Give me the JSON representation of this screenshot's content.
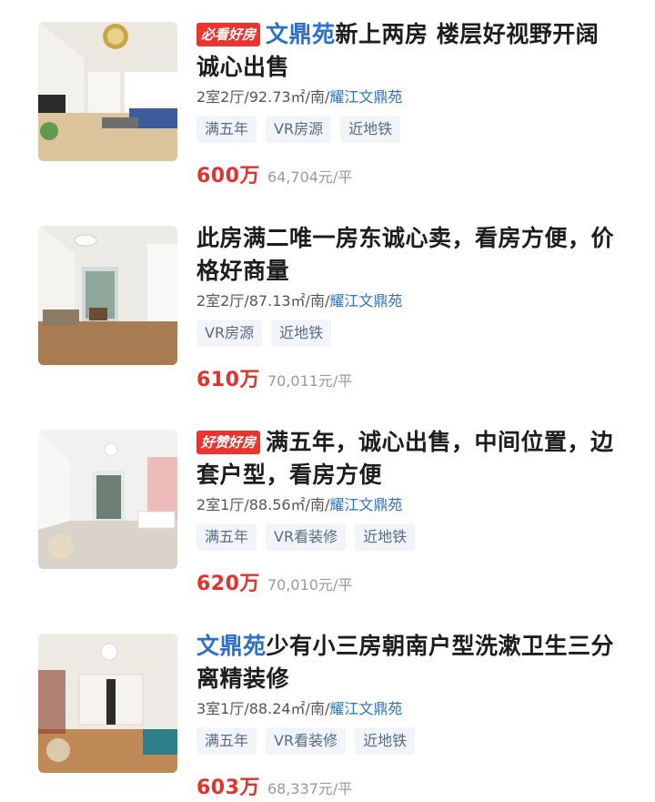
{
  "listings": [
    {
      "badge": "必看好房",
      "title_keyword": "文鼎苑",
      "title": "新上两房  楼层好视野开阔 诚心出售",
      "meta_prefix": "2室2厅/92.73㎡/南/",
      "community": "耀江文鼎苑",
      "tags": [
        "满五年",
        "VR房源",
        "近地铁"
      ],
      "price": "600万",
      "unit_price": "64,704元/平",
      "colors": {
        "wall": "#e9e6df",
        "floor": "#d9c29c",
        "sofa": "#3b5a99"
      }
    },
    {
      "badge": "",
      "title_keyword": "",
      "title": "此房满二唯一房东诚心卖，看房方便，价格好商量",
      "meta_prefix": "2室2厅/87.13㎡/南/",
      "community": "耀江文鼎苑",
      "tags": [
        "VR房源",
        "近地铁"
      ],
      "price": "610万",
      "unit_price": "70,011元/平",
      "colors": {
        "wall": "#ecebe7",
        "floor": "#a87a52",
        "sofa": "#8c7b66"
      }
    },
    {
      "badge": "好赞好房",
      "title_keyword": "",
      "title": "满五年，诚心出售，中间位置，边套户型，看房方便",
      "meta_prefix": "2室1厅/88.56㎡/南/",
      "community": "耀江文鼎苑",
      "tags": [
        "满五年",
        "VR看装修",
        "近地铁"
      ],
      "price": "620万",
      "unit_price": "70,010元/平",
      "colors": {
        "wall": "#f1f1ef",
        "floor": "#d8d2c8",
        "sofa": "#cfcfcf"
      }
    },
    {
      "badge": "",
      "title_keyword": "文鼎苑",
      "title": "少有小三房朝南户型洗漱卫生三分离精装修",
      "meta_prefix": "3室1厅/88.24㎡/南/",
      "community": "耀江文鼎苑",
      "tags": [
        "满五年",
        "VR看装修",
        "近地铁"
      ],
      "price": "603万",
      "unit_price": "68,337元/平",
      "colors": {
        "wall": "#eeeae4",
        "floor": "#c08a58",
        "sofa": "#2f7f8a"
      }
    }
  ]
}
